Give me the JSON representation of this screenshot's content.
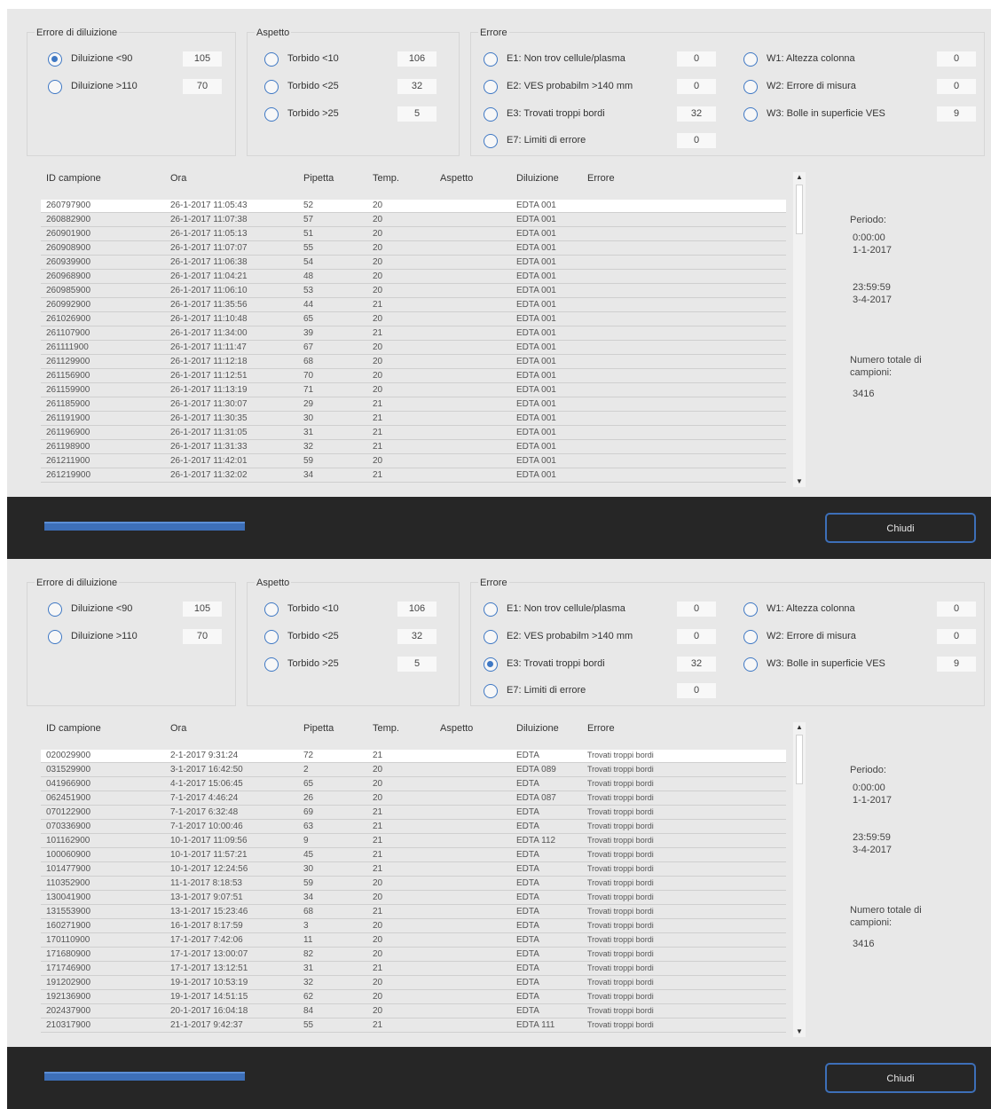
{
  "panels": [
    {
      "filters": {
        "dilution": {
          "title": "Errore di diluizione",
          "options": [
            {
              "label": "Diluizione <90",
              "count": "105",
              "checked": true
            },
            {
              "label": "Diluizione >110",
              "count": "70",
              "checked": false
            }
          ]
        },
        "aspect": {
          "title": "Aspetto",
          "options": [
            {
              "label": "Torbido <10",
              "count": "106",
              "checked": false
            },
            {
              "label": "Torbido <25",
              "count": "32",
              "checked": false
            },
            {
              "label": "Torbido >25",
              "count": "5",
              "checked": false
            }
          ]
        },
        "error": {
          "title": "Errore",
          "options": [
            {
              "label": "E1: Non trov cellule/plasma",
              "count": "0",
              "checked": false
            },
            {
              "label": "E2: VES probabilm >140 mm",
              "count": "0",
              "checked": false
            },
            {
              "label": "E3: Trovati troppi bordi",
              "count": "32",
              "checked": false
            },
            {
              "label": "E7: Limiti di errore",
              "count": "0",
              "checked": false
            }
          ],
          "warnings": [
            {
              "label": "W1: Altezza colonna",
              "count": "0",
              "checked": false
            },
            {
              "label": "W2: Errore di misura",
              "count": "0",
              "checked": false
            },
            {
              "label": "W3: Bolle in superficie VES",
              "count": "9",
              "checked": false
            }
          ]
        }
      },
      "table": {
        "headers": [
          "ID campione",
          "Ora",
          "Pipetta",
          "Temp.",
          "Aspetto",
          "Diluizione",
          "Errore"
        ],
        "rows": [
          [
            "260797900",
            "26-1-2017 11:05:43",
            "52",
            "20",
            "",
            "EDTA 001",
            ""
          ],
          [
            "260882900",
            "26-1-2017 11:07:38",
            "57",
            "20",
            "",
            "EDTA 001",
            ""
          ],
          [
            "260901900",
            "26-1-2017 11:05:13",
            "51",
            "20",
            "",
            "EDTA 001",
            ""
          ],
          [
            "260908900",
            "26-1-2017 11:07:07",
            "55",
            "20",
            "",
            "EDTA 001",
            ""
          ],
          [
            "260939900",
            "26-1-2017 11:06:38",
            "54",
            "20",
            "",
            "EDTA 001",
            ""
          ],
          [
            "260968900",
            "26-1-2017 11:04:21",
            "48",
            "20",
            "",
            "EDTA 001",
            ""
          ],
          [
            "260985900",
            "26-1-2017 11:06:10",
            "53",
            "20",
            "",
            "EDTA 001",
            ""
          ],
          [
            "260992900",
            "26-1-2017 11:35:56",
            "44",
            "21",
            "",
            "EDTA 001",
            ""
          ],
          [
            "261026900",
            "26-1-2017 11:10:48",
            "65",
            "20",
            "",
            "EDTA 001",
            ""
          ],
          [
            "261107900",
            "26-1-2017 11:34:00",
            "39",
            "21",
            "",
            "EDTA 001",
            ""
          ],
          [
            "261111900",
            "26-1-2017 11:11:47",
            "67",
            "20",
            "",
            "EDTA 001",
            ""
          ],
          [
            "261129900",
            "26-1-2017 11:12:18",
            "68",
            "20",
            "",
            "EDTA 001",
            ""
          ],
          [
            "261156900",
            "26-1-2017 11:12:51",
            "70",
            "20",
            "",
            "EDTA 001",
            ""
          ],
          [
            "261159900",
            "26-1-2017 11:13:19",
            "71",
            "20",
            "",
            "EDTA 001",
            ""
          ],
          [
            "261185900",
            "26-1-2017 11:30:07",
            "29",
            "21",
            "",
            "EDTA 001",
            ""
          ],
          [
            "261191900",
            "26-1-2017 11:30:35",
            "30",
            "21",
            "",
            "EDTA 001",
            ""
          ],
          [
            "261196900",
            "26-1-2017 11:31:05",
            "31",
            "21",
            "",
            "EDTA 001",
            ""
          ],
          [
            "261198900",
            "26-1-2017 11:31:33",
            "32",
            "21",
            "",
            "EDTA 001",
            ""
          ],
          [
            "261211900",
            "26-1-2017 11:42:01",
            "59",
            "20",
            "",
            "EDTA 001",
            ""
          ],
          [
            "261219900",
            "26-1-2017 11:32:02",
            "34",
            "21",
            "",
            "EDTA 001",
            ""
          ]
        ]
      },
      "side": {
        "period_label": "Periodo:",
        "start_time": "0:00:00",
        "start_date": "1-1-2017",
        "end_time": "23:59:59",
        "end_date": "3-4-2017",
        "total_label_1": "Numero totale di",
        "total_label_2": "campioni:",
        "total_value": "3416"
      },
      "footer": {
        "close_label": "Chiudi",
        "progress": 1.0
      }
    },
    {
      "filters": {
        "dilution": {
          "title": "Errore di diluizione",
          "options": [
            {
              "label": "Diluizione <90",
              "count": "105",
              "checked": false
            },
            {
              "label": "Diluizione >110",
              "count": "70",
              "checked": false
            }
          ]
        },
        "aspect": {
          "title": "Aspetto",
          "options": [
            {
              "label": "Torbido <10",
              "count": "106",
              "checked": false
            },
            {
              "label": "Torbido <25",
              "count": "32",
              "checked": false
            },
            {
              "label": "Torbido >25",
              "count": "5",
              "checked": false
            }
          ]
        },
        "error": {
          "title": "Errore",
          "options": [
            {
              "label": "E1: Non trov cellule/plasma",
              "count": "0",
              "checked": false
            },
            {
              "label": "E2: VES probabilm >140 mm",
              "count": "0",
              "checked": false
            },
            {
              "label": "E3: Trovati troppi bordi",
              "count": "32",
              "checked": true
            },
            {
              "label": "E7: Limiti di errore",
              "count": "0",
              "checked": false
            }
          ],
          "warnings": [
            {
              "label": "W1: Altezza colonna",
              "count": "0",
              "checked": false
            },
            {
              "label": "W2: Errore di misura",
              "count": "0",
              "checked": false
            },
            {
              "label": "W3: Bolle in superficie VES",
              "count": "9",
              "checked": false
            }
          ]
        }
      },
      "table": {
        "headers": [
          "ID campione",
          "Ora",
          "Pipetta",
          "Temp.",
          "Aspetto",
          "Diluizione",
          "Errore"
        ],
        "rows": [
          [
            "020029900",
            "2-1-2017 9:31:24",
            "72",
            "21",
            "",
            "EDTA",
            "Trovati troppi bordi"
          ],
          [
            "031529900",
            "3-1-2017 16:42:50",
            "2",
            "20",
            "",
            "EDTA 089",
            "Trovati troppi bordi"
          ],
          [
            "041966900",
            "4-1-2017 15:06:45",
            "65",
            "20",
            "",
            "EDTA",
            "Trovati troppi bordi"
          ],
          [
            "062451900",
            "7-1-2017 4:46:24",
            "26",
            "20",
            "",
            "EDTA 087",
            "Trovati troppi bordi"
          ],
          [
            "070122900",
            "7-1-2017 6:32:48",
            "69",
            "21",
            "",
            "EDTA",
            "Trovati troppi bordi"
          ],
          [
            "070336900",
            "7-1-2017 10:00:46",
            "63",
            "21",
            "",
            "EDTA",
            "Trovati troppi bordi"
          ],
          [
            "101162900",
            "10-1-2017 11:09:56",
            "9",
            "21",
            "",
            "EDTA 112",
            "Trovati troppi bordi"
          ],
          [
            "100060900",
            "10-1-2017 11:57:21",
            "45",
            "21",
            "",
            "EDTA",
            "Trovati troppi bordi"
          ],
          [
            "101477900",
            "10-1-2017 12:24:56",
            "30",
            "21",
            "",
            "EDTA",
            "Trovati troppi bordi"
          ],
          [
            "110352900",
            "11-1-2017 8:18:53",
            "59",
            "20",
            "",
            "EDTA",
            "Trovati troppi bordi"
          ],
          [
            "130041900",
            "13-1-2017 9:07:51",
            "34",
            "20",
            "",
            "EDTA",
            "Trovati troppi bordi"
          ],
          [
            "131553900",
            "13-1-2017 15:23:46",
            "68",
            "21",
            "",
            "EDTA",
            "Trovati troppi bordi"
          ],
          [
            "160271900",
            "16-1-2017 8:17:59",
            "3",
            "20",
            "",
            "EDTA",
            "Trovati troppi bordi"
          ],
          [
            "170110900",
            "17-1-2017 7:42:06",
            "11",
            "20",
            "",
            "EDTA",
            "Trovati troppi bordi"
          ],
          [
            "171680900",
            "17-1-2017 13:00:07",
            "82",
            "20",
            "",
            "EDTA",
            "Trovati troppi bordi"
          ],
          [
            "171746900",
            "17-1-2017 13:12:51",
            "31",
            "21",
            "",
            "EDTA",
            "Trovati troppi bordi"
          ],
          [
            "191202900",
            "19-1-2017 10:53:19",
            "32",
            "20",
            "",
            "EDTA",
            "Trovati troppi bordi"
          ],
          [
            "192136900",
            "19-1-2017 14:51:15",
            "62",
            "20",
            "",
            "EDTA",
            "Trovati troppi bordi"
          ],
          [
            "202437900",
            "20-1-2017 16:04:18",
            "84",
            "20",
            "",
            "EDTA",
            "Trovati troppi bordi"
          ],
          [
            "210317900",
            "21-1-2017 9:42:37",
            "55",
            "21",
            "",
            "EDTA 111",
            "Trovati troppi bordi"
          ]
        ]
      },
      "side": {
        "period_label": "Periodo:",
        "start_time": "0:00:00",
        "start_date": "1-1-2017",
        "end_time": "23:59:59",
        "end_date": "3-4-2017",
        "total_label_1": "Numero totale di",
        "total_label_2": "campioni:",
        "total_value": "3416"
      },
      "footer": {
        "close_label": "Chiudi",
        "progress": 1.0
      }
    }
  ],
  "colors": {
    "accent": "#3f78c4",
    "panel_bg": "#e8e8e8",
    "footer_bg": "#262626"
  },
  "icons": {
    "scroll_up": "▲",
    "scroll_down": "▼"
  }
}
